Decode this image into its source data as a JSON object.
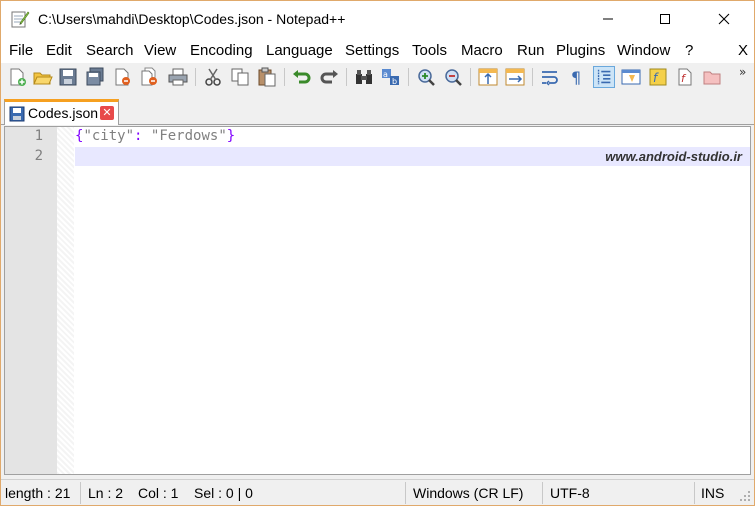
{
  "window": {
    "title": "C:\\Users\\mahdi\\Desktop\\Codes.json - Notepad++"
  },
  "menu": {
    "items": [
      "File",
      "Edit",
      "Search",
      "View",
      "Encoding",
      "Language",
      "Settings",
      "Tools",
      "Macro",
      "Run",
      "Plugins",
      "Window",
      "?"
    ],
    "close_glyph": "X"
  },
  "toolbar": {
    "overflow_glyph": "»",
    "icons": [
      "new-file-icon",
      "open-file-icon",
      "save-icon",
      "save-all-icon",
      "close-icon",
      "close-all-icon",
      "print-icon",
      "cut-icon",
      "copy-icon",
      "paste-icon",
      "undo-icon",
      "redo-icon",
      "find-icon",
      "replace-icon",
      "zoom-in-icon",
      "zoom-out-icon",
      "sync-vertical-icon",
      "sync-horizontal-icon",
      "word-wrap-icon",
      "show-all-chars-icon",
      "indent-guide-icon",
      "doc-map-icon",
      "function-list-icon",
      "folder-workspace-icon",
      "record-macro-icon"
    ]
  },
  "tabs": [
    {
      "label": "Codes.json",
      "active": true
    }
  ],
  "editor": {
    "lines": [
      {
        "number": "1",
        "open_brace": "{",
        "key": "\"city\"",
        "colon": ":",
        "space": " ",
        "value": "\"Ferdows\"",
        "close_brace": "}"
      },
      {
        "number": "2",
        "text": ""
      }
    ],
    "watermark": "www.android-studio.ir",
    "colors": {
      "brace": "#8000ff",
      "string": "#808080",
      "current_line": "#e8e8ff"
    }
  },
  "status": {
    "length": "length : 21",
    "ln": "Ln : 2",
    "col": "Col : 1",
    "sel": "Sel : 0 | 0",
    "eol": "Windows (CR LF)",
    "encoding": "UTF-8",
    "mode": "INS"
  }
}
